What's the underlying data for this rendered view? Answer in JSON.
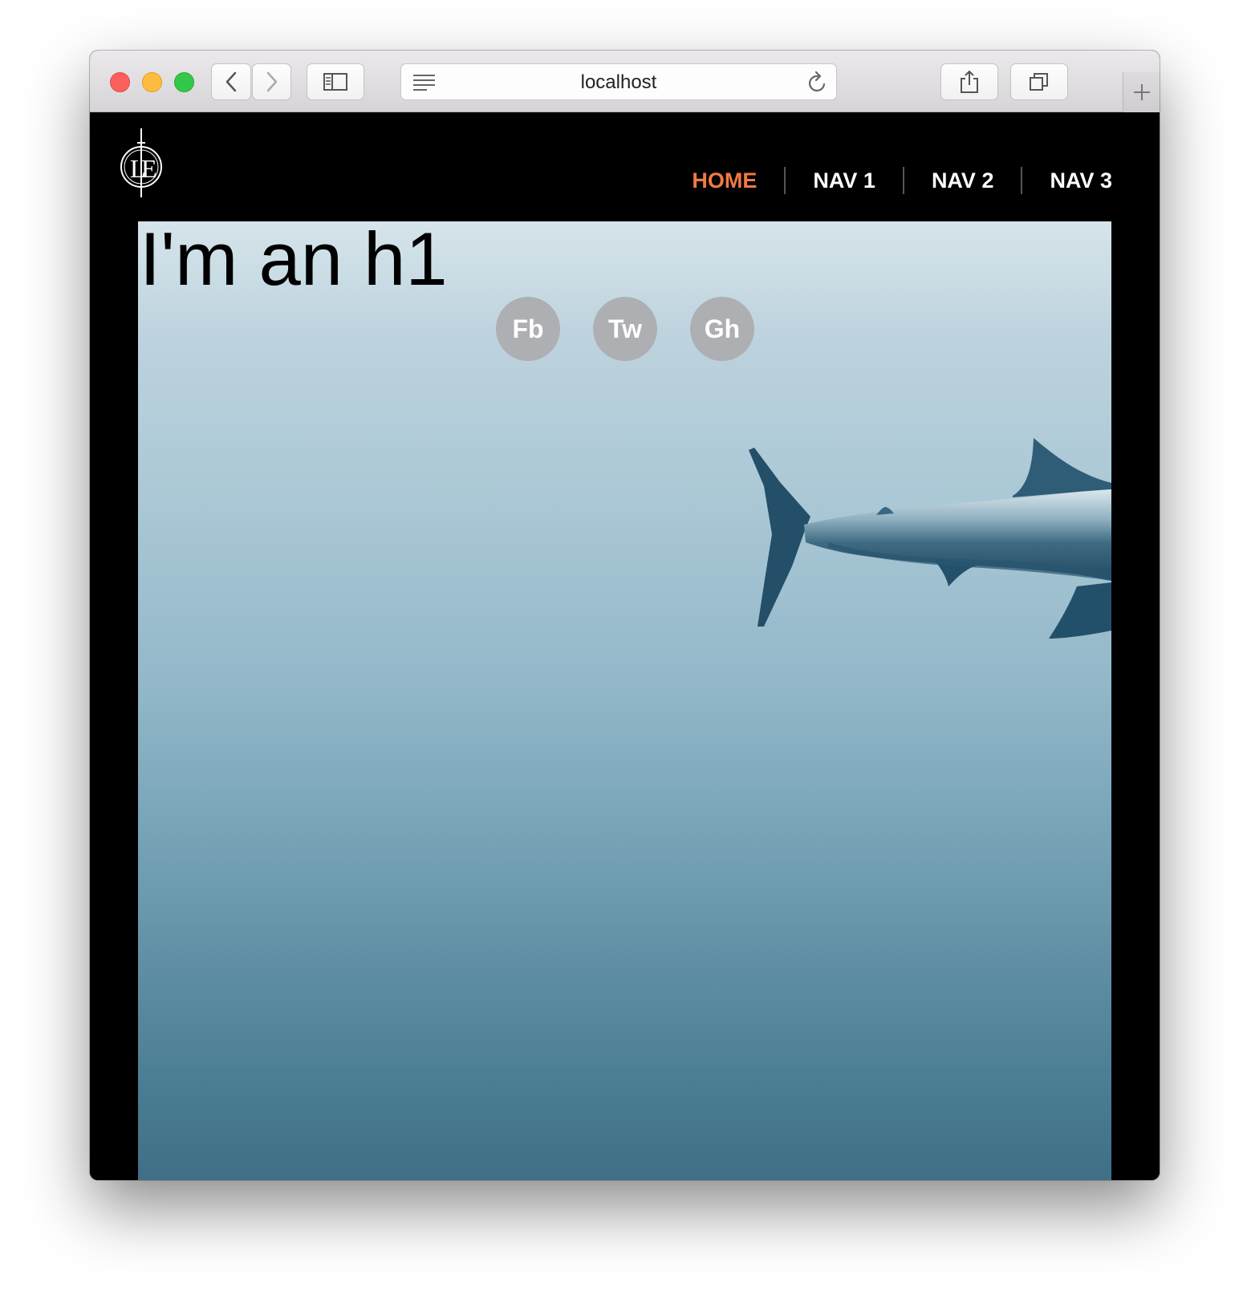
{
  "browser": {
    "url": "localhost",
    "icons": [
      "back-icon",
      "forward-icon",
      "sidebar-icon",
      "reader-icon",
      "reload-icon",
      "share-icon",
      "tabs-icon",
      "plus-icon"
    ]
  },
  "site": {
    "nav": [
      {
        "label": "HOME",
        "active": true
      },
      {
        "label": "NAV 1",
        "active": false
      },
      {
        "label": "NAV 2",
        "active": false
      },
      {
        "label": "NAV 3",
        "active": false
      }
    ],
    "heading": "I'm an h1",
    "social": [
      "Fb",
      "Tw",
      "Gh"
    ],
    "colors": {
      "background": "#000000",
      "nav_active": "#f07a43",
      "nav_text": "#ffffff",
      "social_bg": "#adafb2"
    }
  }
}
